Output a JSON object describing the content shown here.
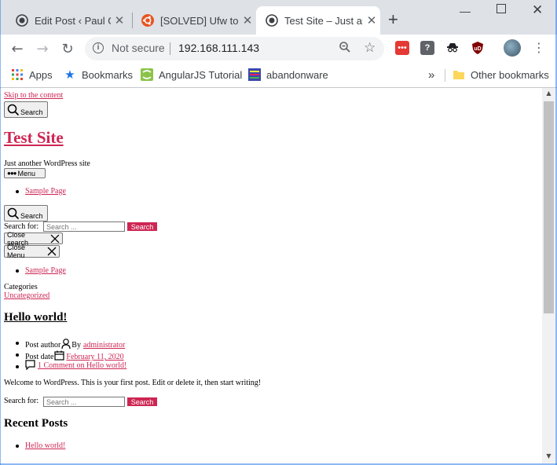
{
  "tabs": [
    {
      "title": "Edit Post ‹ Paul Ge",
      "favicon": "wordpress-icon"
    },
    {
      "title": "[SOLVED] Ufw to l",
      "favicon": "ubuntu-icon"
    },
    {
      "title": "Test Site – Just an",
      "favicon": "wordpress-icon",
      "active": true
    }
  ],
  "toolbar": {
    "security_label": "Not secure",
    "url": "192.168.111.143"
  },
  "bookmarks": {
    "items": [
      {
        "label": "Apps",
        "icon": "apps-grid-icon"
      },
      {
        "label": "Bookmarks",
        "icon": "star-icon"
      },
      {
        "label": "AngularJS Tutorial",
        "icon": "angular-icon"
      },
      {
        "label": "abandonware",
        "icon": "abandonware-icon"
      }
    ],
    "overflow": "»",
    "other": "Other bookmarks"
  },
  "page": {
    "skip_link": "Skip to the content",
    "search_toggle": "Search",
    "site_title": "Test Site",
    "site_description": "Just another WordPress site",
    "menu_toggle": "Menu",
    "nav_item": "Sample Page",
    "search_toggle_2": "Search",
    "search_label": "Search for:",
    "search_placeholder": "Search ...",
    "search_submit": "Search",
    "close_search": "Close search",
    "close_menu": "Close Menu",
    "nav_item_2": "Sample Page",
    "categories_label": "Categories",
    "category": "Uncategorized",
    "post_title": "Hello world!",
    "post_author_label": "Post author",
    "post_author_by": "By",
    "post_author": "administrator",
    "post_date_label": "Post date",
    "post_date": "February 11, 2020",
    "comments_link": "1 Comment on Hello world!",
    "post_content": "Welcome to WordPress. This is your first post. Edit or delete it, then start writing!",
    "search_label_2": "Search for:",
    "search_placeholder_2": "Search ...",
    "search_submit_2": "Search",
    "recent_posts_heading": "Recent Posts",
    "recent_post": "Hello world!"
  },
  "colors": {
    "accent": "#cd2653",
    "chrome_bg": "#dee1e6"
  }
}
